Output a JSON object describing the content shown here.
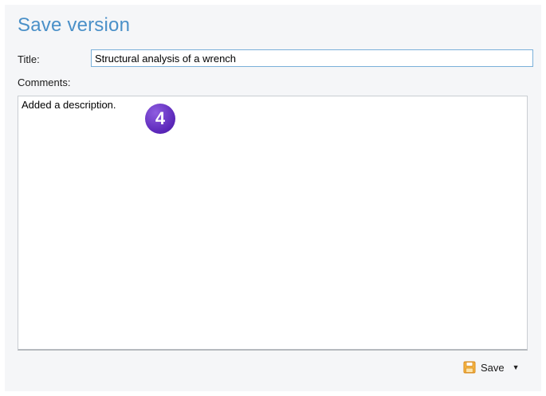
{
  "dialog": {
    "heading": "Save version",
    "title_label": "Title:",
    "title_value": "Structural analysis of a wrench",
    "comments_label": "Comments:",
    "comments_value": "Added a description.",
    "callout_number": "4",
    "save_label": "Save",
    "save_icon": "floppy-disk-icon",
    "dropdown_icon": "caret-down-icon"
  },
  "colors": {
    "heading": "#4a90c8",
    "panel_bg": "#f5f6f8",
    "input_border_focus": "#7ab0d9",
    "callout": "#6a35c9",
    "save_icon": "#f0a030"
  }
}
